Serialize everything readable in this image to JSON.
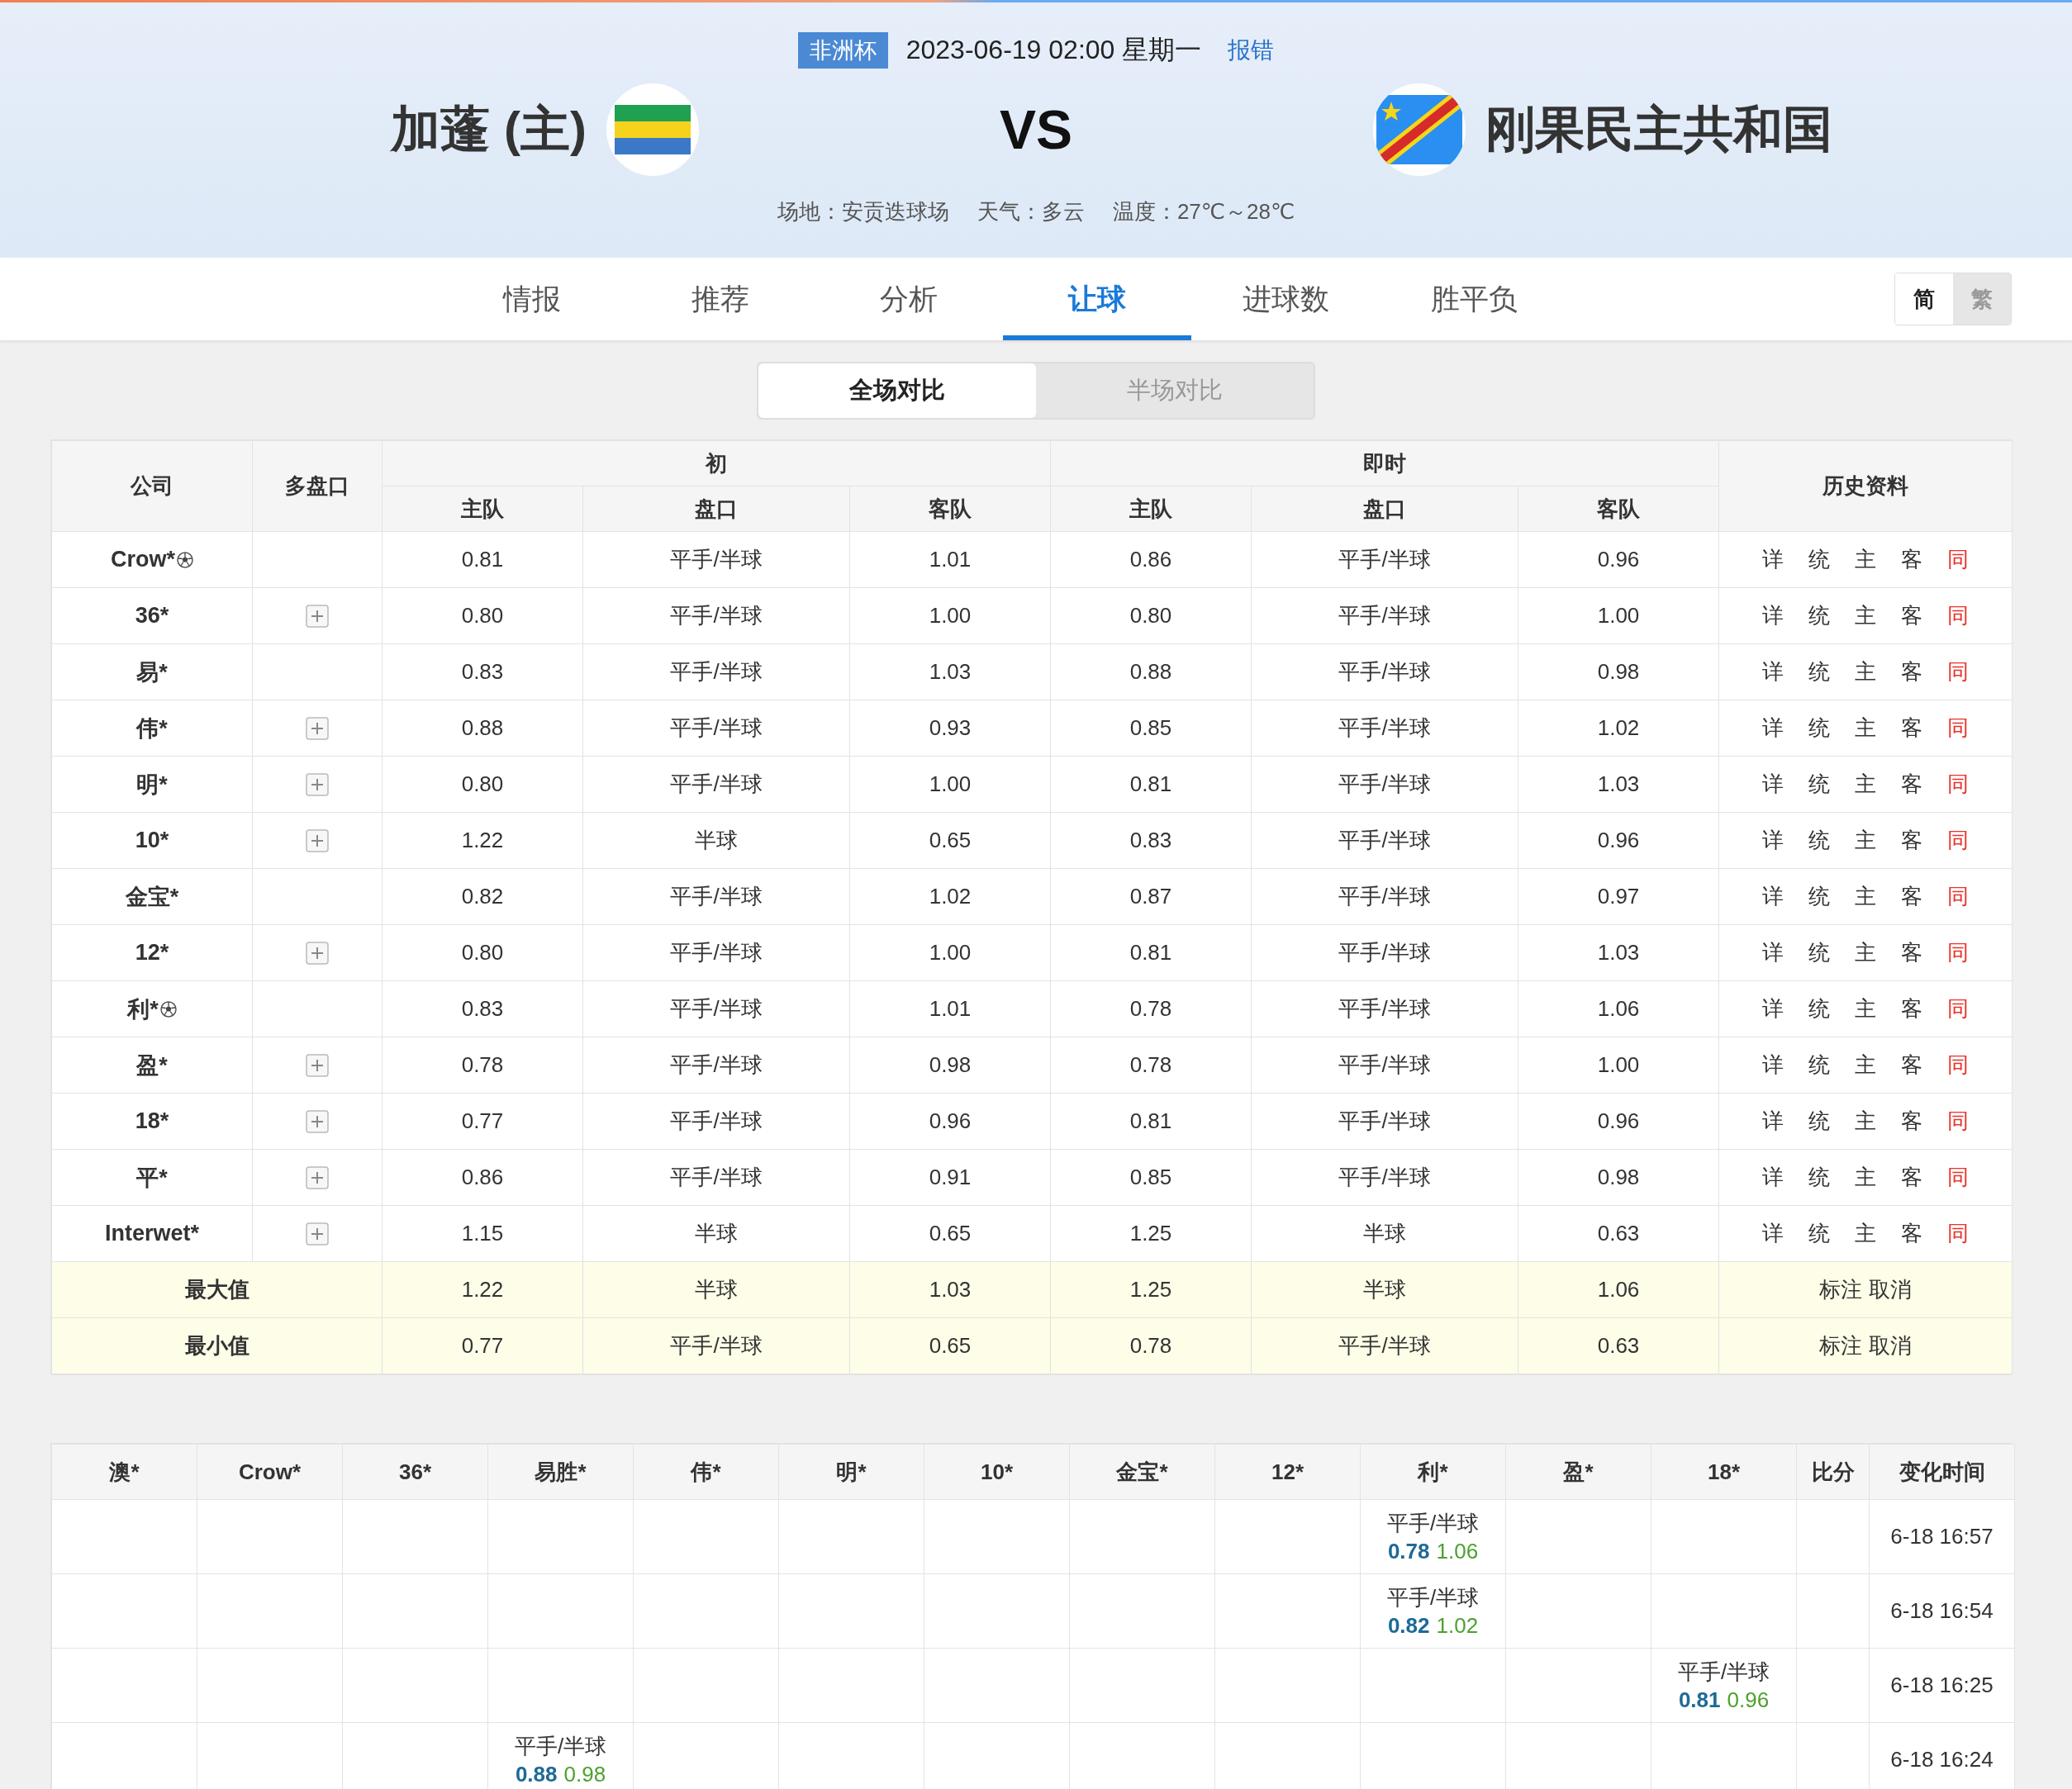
{
  "match": {
    "competition": "非洲杯",
    "datetime": "2023-06-19 02:00 星期一",
    "report_link": "报错",
    "home_team": "加蓬 (主)",
    "vs": "VS",
    "away_team": "刚果民主共和国",
    "venue": "场地：安贡迭球场",
    "weather": "天气：多云",
    "temperature": "温度：27℃～28℃"
  },
  "tabs": [
    {
      "label": "情报",
      "selected": false
    },
    {
      "label": "推荐",
      "selected": false
    },
    {
      "label": "分析",
      "selected": false
    },
    {
      "label": "让球",
      "selected": true
    },
    {
      "label": "进球数",
      "selected": false
    },
    {
      "label": "胜平负",
      "selected": false
    }
  ],
  "script_toggle": [
    {
      "label": "简",
      "selected": true
    },
    {
      "label": "繁",
      "selected": false
    }
  ],
  "compare_toggle": [
    {
      "label": "全场对比",
      "selected": true
    },
    {
      "label": "半场对比",
      "selected": false
    }
  ],
  "odds_table": {
    "columns": {
      "company": "公司",
      "multi": "多盘口",
      "initial": "初",
      "live": "即时",
      "history": "历史资料",
      "sub": [
        "主队",
        "盘口",
        "客队",
        "主队",
        "盘口",
        "客队"
      ]
    },
    "rows": [
      {
        "company": "Crow*",
        "ball": true,
        "multi": false,
        "initial": [
          "0.81",
          "平手/半球",
          "1.01"
        ],
        "live": [
          "0.86",
          "平手/半球",
          "0.96"
        ],
        "links": [
          "详",
          "统",
          "主",
          "客",
          "同"
        ]
      },
      {
        "company": "36*",
        "ball": false,
        "multi": true,
        "initial": [
          "0.80",
          "平手/半球",
          "1.00"
        ],
        "live": [
          "0.80",
          "平手/半球",
          "1.00"
        ],
        "links": [
          "详",
          "统",
          "主",
          "客",
          "同"
        ]
      },
      {
        "company": "易*",
        "ball": false,
        "multi": false,
        "initial": [
          "0.83",
          "平手/半球",
          "1.03"
        ],
        "live": [
          "0.88",
          "平手/半球",
          "0.98"
        ],
        "links": [
          "详",
          "统",
          "主",
          "客",
          "同"
        ]
      },
      {
        "company": "伟*",
        "ball": false,
        "multi": true,
        "initial": [
          "0.88",
          "平手/半球",
          "0.93"
        ],
        "live": [
          "0.85",
          "平手/半球",
          "1.02"
        ],
        "links": [
          "详",
          "统",
          "主",
          "客",
          "同"
        ]
      },
      {
        "company": "明*",
        "ball": false,
        "multi": true,
        "initial": [
          "0.80",
          "平手/半球",
          "1.00"
        ],
        "live": [
          "0.81",
          "平手/半球",
          "1.03"
        ],
        "links": [
          "详",
          "统",
          "主",
          "客",
          "同"
        ]
      },
      {
        "company": "10*",
        "ball": false,
        "multi": true,
        "initial": [
          "1.22",
          "半球",
          "0.65"
        ],
        "live": [
          "0.83",
          "平手/半球",
          "0.96"
        ],
        "links": [
          "详",
          "统",
          "主",
          "客",
          "同"
        ]
      },
      {
        "company": "金宝*",
        "ball": false,
        "multi": false,
        "initial": [
          "0.82",
          "平手/半球",
          "1.02"
        ],
        "live": [
          "0.87",
          "平手/半球",
          "0.97"
        ],
        "links": [
          "详",
          "统",
          "主",
          "客",
          "同"
        ]
      },
      {
        "company": "12*",
        "ball": false,
        "multi": true,
        "initial": [
          "0.80",
          "平手/半球",
          "1.00"
        ],
        "live": [
          "0.81",
          "平手/半球",
          "1.03"
        ],
        "links": [
          "详",
          "统",
          "主",
          "客",
          "同"
        ]
      },
      {
        "company": "利*",
        "ball": true,
        "multi": false,
        "initial": [
          "0.83",
          "平手/半球",
          "1.01"
        ],
        "live": [
          "0.78",
          "平手/半球",
          "1.06"
        ],
        "links": [
          "详",
          "统",
          "主",
          "客",
          "同"
        ]
      },
      {
        "company": "盈*",
        "ball": false,
        "multi": true,
        "initial": [
          "0.78",
          "平手/半球",
          "0.98"
        ],
        "live": [
          "0.78",
          "平手/半球",
          "1.00"
        ],
        "links": [
          "详",
          "统",
          "主",
          "客",
          "同"
        ]
      },
      {
        "company": "18*",
        "ball": false,
        "multi": true,
        "initial": [
          "0.77",
          "平手/半球",
          "0.96"
        ],
        "live": [
          "0.81",
          "平手/半球",
          "0.96"
        ],
        "links": [
          "详",
          "统",
          "主",
          "客",
          "同"
        ]
      },
      {
        "company": "平*",
        "ball": false,
        "multi": true,
        "initial": [
          "0.86",
          "平手/半球",
          "0.91"
        ],
        "live": [
          "0.85",
          "平手/半球",
          "0.98"
        ],
        "links": [
          "详",
          "统",
          "主",
          "客",
          "同"
        ]
      },
      {
        "company": "Interwet*",
        "ball": false,
        "multi": true,
        "initial": [
          "1.15",
          "半球",
          "0.65"
        ],
        "live": [
          "1.25",
          "半球",
          "0.63"
        ],
        "links": [
          "详",
          "统",
          "主",
          "客",
          "同"
        ]
      }
    ],
    "summary": [
      {
        "label": "最大值",
        "initial": [
          "1.22",
          "半球",
          "1.03"
        ],
        "live": [
          "1.25",
          "半球",
          "1.06"
        ],
        "links": [
          "标注",
          "取消"
        ]
      },
      {
        "label": "最小值",
        "initial": [
          "0.77",
          "平手/半球",
          "0.65"
        ],
        "live": [
          "0.78",
          "平手/半球",
          "0.63"
        ],
        "links": [
          "标注",
          "取消"
        ]
      }
    ]
  },
  "change_table": {
    "columns": [
      "澳*",
      "Crow*",
      "36*",
      "易胜*",
      "伟*",
      "明*",
      "10*",
      "金宝*",
      "12*",
      "利*",
      "盈*",
      "18*",
      "比分",
      "变化时间"
    ],
    "rows": [
      {
        "cells": [
          {
            "kind": "empty"
          },
          {
            "kind": "empty"
          },
          {
            "kind": "empty"
          },
          {
            "kind": "empty"
          },
          {
            "kind": "empty"
          },
          {
            "kind": "empty"
          },
          {
            "kind": "empty"
          },
          {
            "kind": "empty"
          },
          {
            "kind": "empty"
          },
          {
            "kind": "odds",
            "line": "平手/半球",
            "home": "0.78",
            "away": "1.06"
          },
          {
            "kind": "empty"
          },
          {
            "kind": "empty"
          },
          {
            "kind": "empty"
          }
        ],
        "time": "6-18 16:57"
      },
      {
        "cells": [
          {
            "kind": "empty"
          },
          {
            "kind": "empty"
          },
          {
            "kind": "empty"
          },
          {
            "kind": "empty"
          },
          {
            "kind": "empty"
          },
          {
            "kind": "empty"
          },
          {
            "kind": "empty"
          },
          {
            "kind": "empty"
          },
          {
            "kind": "empty"
          },
          {
            "kind": "odds",
            "line": "平手/半球",
            "home": "0.82",
            "away": "1.02"
          },
          {
            "kind": "empty"
          },
          {
            "kind": "empty"
          },
          {
            "kind": "empty"
          }
        ],
        "time": "6-18 16:54"
      },
      {
        "cells": [
          {
            "kind": "empty"
          },
          {
            "kind": "empty"
          },
          {
            "kind": "empty"
          },
          {
            "kind": "empty"
          },
          {
            "kind": "empty"
          },
          {
            "kind": "empty"
          },
          {
            "kind": "empty"
          },
          {
            "kind": "empty"
          },
          {
            "kind": "empty"
          },
          {
            "kind": "empty"
          },
          {
            "kind": "empty"
          },
          {
            "kind": "odds",
            "line": "平手/半球",
            "home": "0.81",
            "away": "0.96"
          },
          {
            "kind": "empty"
          }
        ],
        "time": "6-18 16:25"
      },
      {
        "cells": [
          {
            "kind": "empty"
          },
          {
            "kind": "empty"
          },
          {
            "kind": "empty"
          },
          {
            "kind": "odds",
            "line": "平手/半球",
            "home": "0.88",
            "away": "0.98"
          },
          {
            "kind": "empty"
          },
          {
            "kind": "empty"
          },
          {
            "kind": "empty"
          },
          {
            "kind": "empty"
          },
          {
            "kind": "empty"
          },
          {
            "kind": "empty"
          },
          {
            "kind": "empty"
          },
          {
            "kind": "empty"
          },
          {
            "kind": "empty"
          }
        ],
        "time": "6-18 16:24"
      }
    ]
  }
}
